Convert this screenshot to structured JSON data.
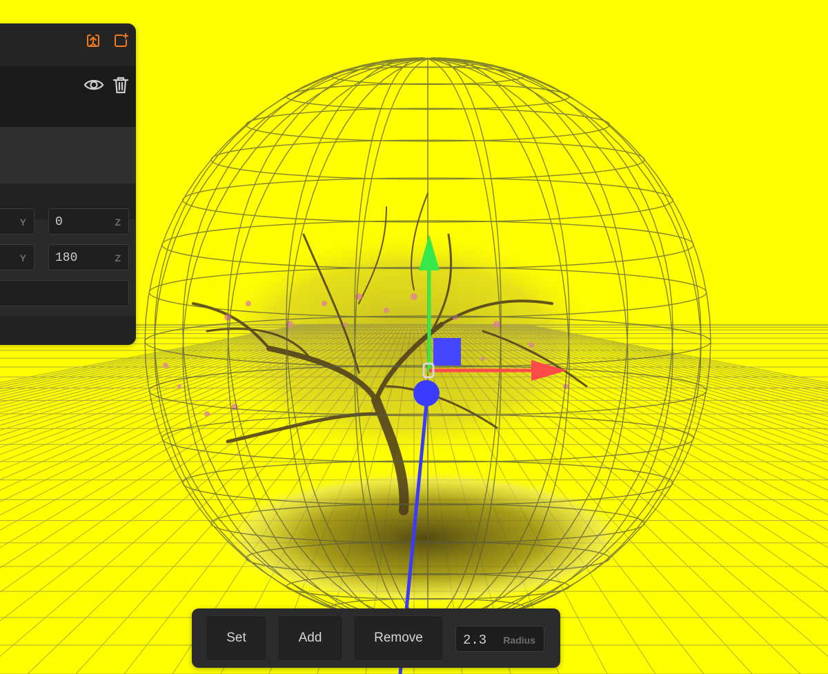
{
  "scene": {
    "background_color": "#ffff00",
    "gizmo_colors": {
      "x_axis": "#ff4a4a",
      "y_axis": "#38e84a",
      "z_axis": "#3b3bff"
    }
  },
  "panel": {
    "header_icons": [
      "export-icon",
      "add-icon"
    ],
    "layer_row_icons": [
      "eye-icon",
      "trash-icon"
    ],
    "position": {
      "y_axis_label": "Y",
      "z_value": "0",
      "z_axis_label": "Z"
    },
    "rotation": {
      "y_axis_label": "Y",
      "z_value": "180",
      "z_axis_label": "Z"
    }
  },
  "toolbar": {
    "set_label": "Set",
    "add_label": "Add",
    "remove_label": "Remove",
    "radius_value": "2.3",
    "radius_label": "Radius"
  }
}
